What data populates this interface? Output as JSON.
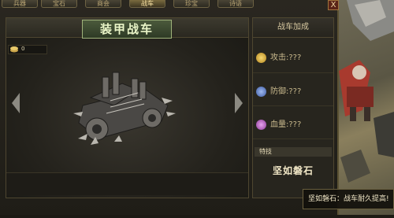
{
  "tabs": [
    {
      "label": "兵器"
    },
    {
      "label": "宝石"
    },
    {
      "label": "商会"
    },
    {
      "label": "战车"
    },
    {
      "label": "珍宝"
    },
    {
      "label": "诗语"
    }
  ],
  "close_label": "X",
  "panel": {
    "title": "装甲战车",
    "currency_value": "0"
  },
  "stats": {
    "header": "战车加成",
    "attack_label": "攻击:???",
    "defense_label": "防御:???",
    "hp_label": "血量:???"
  },
  "skill": {
    "header": "特技",
    "name": "坚如磐石"
  },
  "tooltip": "坚如磐石：战车耐久提高!",
  "colors": {
    "accent": "#eaf5c8",
    "frame_border": "#5b5233",
    "attack": "#e0b23a",
    "defense": "#6c8ec7",
    "hp": "#c070c8"
  }
}
